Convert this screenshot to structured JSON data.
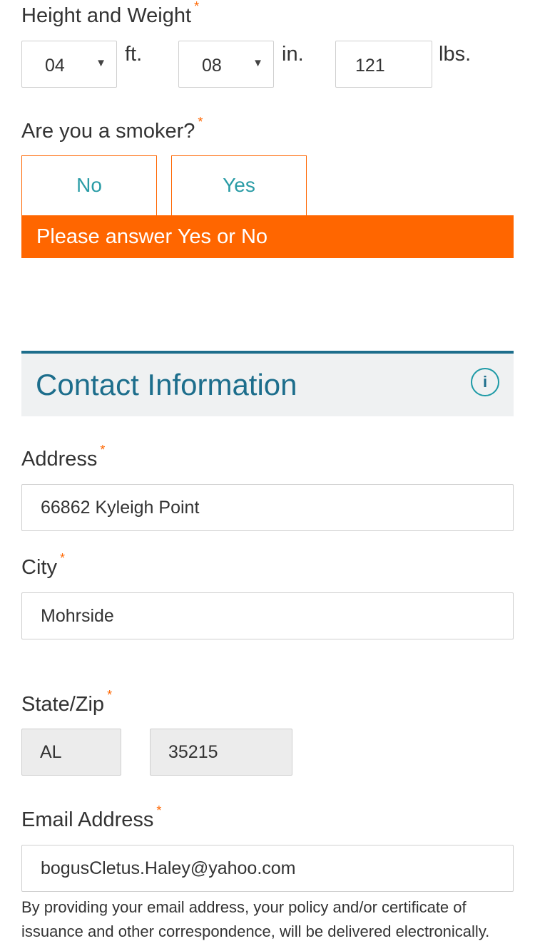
{
  "height_weight": {
    "label": "Height and Weight",
    "required_mark": "*",
    "feet_value": "04",
    "feet_unit": "ft.",
    "inches_value": "08",
    "inches_unit": "in.",
    "weight_value": "121",
    "weight_unit": "lbs.",
    "dropdown_arrow": "▼"
  },
  "smoker": {
    "label": "Are you a smoker?",
    "required_mark": "*",
    "options": [
      "No",
      "Yes"
    ],
    "error": "Please answer Yes or No"
  },
  "contact_section": {
    "title": "Contact Information",
    "info_icon": "i"
  },
  "address": {
    "label": "Address",
    "required_mark": "*",
    "value": "66862 Kyleigh Point"
  },
  "city": {
    "label": "City",
    "required_mark": "*",
    "value": "Mohrside"
  },
  "state_zip": {
    "label": "State/Zip",
    "required_mark": "*",
    "state": "AL",
    "zip": "35215"
  },
  "email": {
    "label": "Email Address",
    "required_mark": "*",
    "value": "bogusCletus.Haley@yahoo.com",
    "note": "By providing your email address, your policy and/or certificate of issuance and other correspondence, will be delivered electronically."
  },
  "colors": {
    "accent_orange": "#ff6600",
    "section_blue": "#1d6e8c",
    "option_teal": "#2a9ca6"
  }
}
